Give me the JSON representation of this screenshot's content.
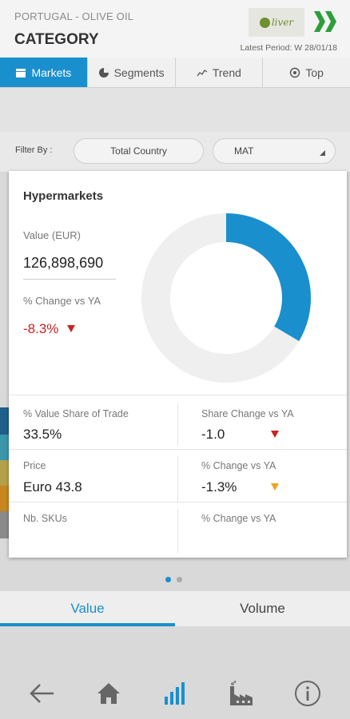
{
  "header": {
    "breadcrumb": "PORTUGAL - OLIVE OIL",
    "title": "CATEGORY",
    "logo_text": "liver",
    "latest_period": "Latest Period: W 28/01/18"
  },
  "tabs": [
    {
      "label": "Markets",
      "icon": "store-icon",
      "active": true
    },
    {
      "label": "Segments",
      "icon": "pie-icon",
      "active": false
    },
    {
      "label": "Trend",
      "icon": "trend-line-icon",
      "active": false
    },
    {
      "label": "Top",
      "icon": "target-icon",
      "active": false
    }
  ],
  "filter": {
    "label": "Filter By :",
    "country": "Total Country",
    "period": "MAT"
  },
  "card": {
    "title": "Hypermarkets",
    "value_label": "Value (EUR)",
    "value": "126,898,690",
    "change_label": "% Change vs YA",
    "change": "-8.3%",
    "donut_share": 0.335,
    "metrics": {
      "share_label": "% Value Share of Trade",
      "share_value": "33.5%",
      "share_change_label": "Share Change vs YA",
      "share_change_value": "-1.0",
      "price_label": "Price",
      "price_value": "Euro  43.8",
      "price_change_label": "% Change vs YA",
      "price_change_value": "-1.3%",
      "skus_label": "Nb. SKUs",
      "skus_change_label": "% Change vs YA"
    }
  },
  "pager": {
    "count": 2,
    "active": 0
  },
  "measure_tabs": [
    {
      "label": "Value",
      "active": true
    },
    {
      "label": "Volume",
      "active": false
    }
  ],
  "bottom_nav": [
    "back-arrow-icon",
    "home-icon",
    "bar-chart-icon",
    "factory-icon",
    "info-icon"
  ],
  "colors": {
    "accent": "#1a8fce",
    "negative": "#cc2222",
    "warning": "#f0a020",
    "strip": [
      "#1f5f8b",
      "#3a96a8",
      "#b4a04a",
      "#c8861f",
      "#8a8a8a"
    ]
  }
}
